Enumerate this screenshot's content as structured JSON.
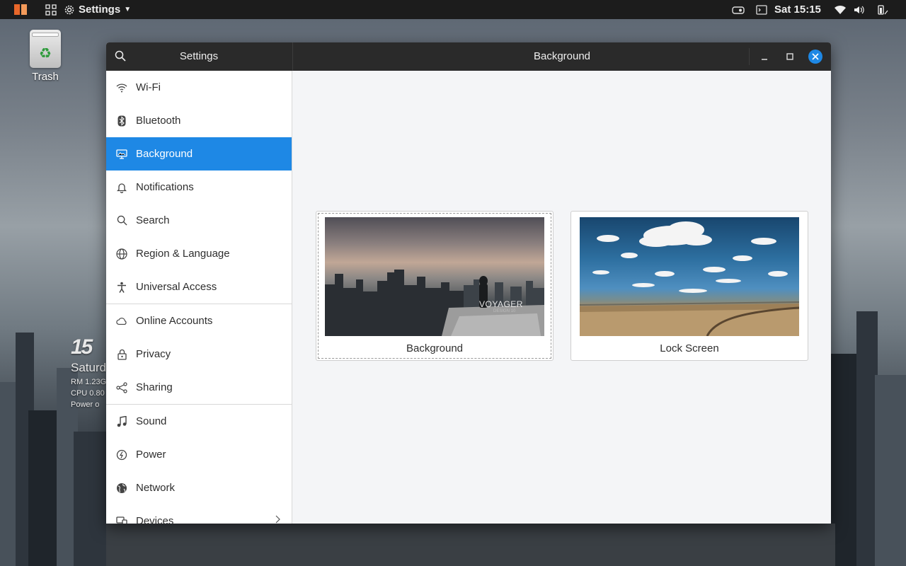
{
  "topbar": {
    "app_menu": "Settings",
    "clock": "Sat 15:15"
  },
  "desktop": {
    "trash_label": "Trash",
    "conky": {
      "big": "15",
      "day": "Saturd",
      "line1": "RM 1.23G",
      "line2": "CPU 0.80",
      "line3": "Power o"
    }
  },
  "window": {
    "sidebar_title": "Settings",
    "main_title": "Background",
    "sidebar": [
      {
        "label": "Wi-Fi",
        "icon": "wifi-icon"
      },
      {
        "label": "Bluetooth",
        "icon": "bluetooth-icon"
      },
      {
        "label": "Background",
        "icon": "display-icon",
        "selected": true
      },
      {
        "label": "Notifications",
        "icon": "bell-icon"
      },
      {
        "label": "Search",
        "icon": "search-icon"
      },
      {
        "label": "Region & Language",
        "icon": "globe-icon"
      },
      {
        "label": "Universal Access",
        "icon": "person-icon"
      },
      {
        "label": "Online Accounts",
        "icon": "cloud-icon"
      },
      {
        "label": "Privacy",
        "icon": "lock-icon"
      },
      {
        "label": "Sharing",
        "icon": "share-icon"
      },
      {
        "label": "Sound",
        "icon": "music-note-icon"
      },
      {
        "label": "Power",
        "icon": "power-icon"
      },
      {
        "label": "Network",
        "icon": "network-globe-icon"
      },
      {
        "label": "Devices",
        "icon": "devices-icon"
      }
    ],
    "cards": [
      {
        "caption": "Background",
        "watermark": "VOYAGER",
        "watermark_sub": "DESIGN 10"
      },
      {
        "caption": "Lock Screen"
      }
    ]
  },
  "colors": {
    "accent": "#1e88e5",
    "header": "#2a2a2a",
    "brand": "#e9672a"
  }
}
